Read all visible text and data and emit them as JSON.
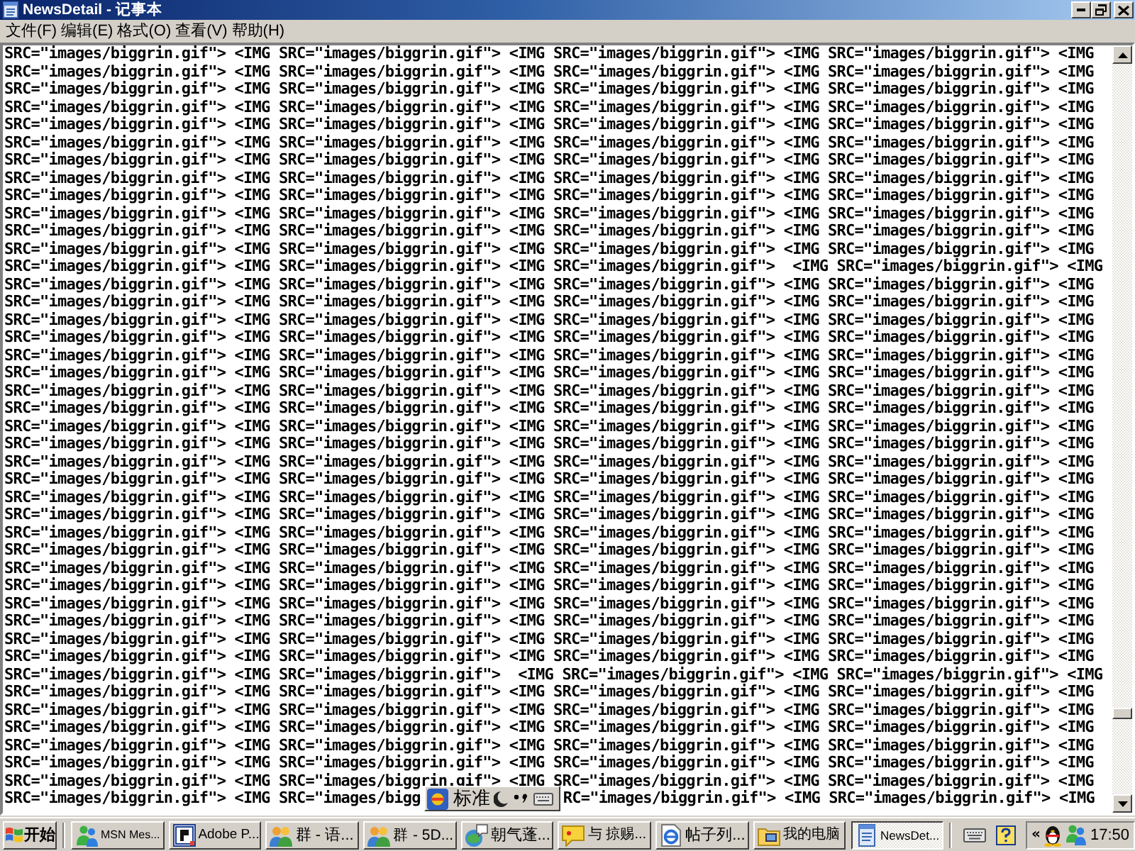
{
  "window": {
    "title": "NewsDetail - 记事本"
  },
  "menu": [
    "文件(F)",
    "编辑(E)",
    "格式(O)",
    "查看(V)",
    "帮助(H)"
  ],
  "editor": {
    "lines": [
      "SRC=\"images/biggrin.gif\"> <IMG SRC=\"images/biggrin.gif\"> <IMG SRC=\"images/biggrin.gif\"> <IMG SRC=\"images/biggrin.gif\"> <IMG",
      "SRC=\"images/biggrin.gif\"> <IMG SRC=\"images/biggrin.gif\"> <IMG SRC=\"images/biggrin.gif\"> <IMG SRC=\"images/biggrin.gif\"> <IMG",
      "SRC=\"images/biggrin.gif\"> <IMG SRC=\"images/biggrin.gif\"> <IMG SRC=\"images/biggrin.gif\"> <IMG SRC=\"images/biggrin.gif\"> <IMG",
      "SRC=\"images/biggrin.gif\"> <IMG SRC=\"images/biggrin.gif\"> <IMG SRC=\"images/biggrin.gif\"> <IMG SRC=\"images/biggrin.gif\"> <IMG",
      "SRC=\"images/biggrin.gif\"> <IMG SRC=\"images/biggrin.gif\"> <IMG SRC=\"images/biggrin.gif\"> <IMG SRC=\"images/biggrin.gif\"> <IMG",
      "SRC=\"images/biggrin.gif\"> <IMG SRC=\"images/biggrin.gif\"> <IMG SRC=\"images/biggrin.gif\"> <IMG SRC=\"images/biggrin.gif\"> <IMG",
      "SRC=\"images/biggrin.gif\"> <IMG SRC=\"images/biggrin.gif\"> <IMG SRC=\"images/biggrin.gif\"> <IMG SRC=\"images/biggrin.gif\"> <IMG",
      "SRC=\"images/biggrin.gif\"> <IMG SRC=\"images/biggrin.gif\"> <IMG SRC=\"images/biggrin.gif\"> <IMG SRC=\"images/biggrin.gif\"> <IMG",
      "SRC=\"images/biggrin.gif\"> <IMG SRC=\"images/biggrin.gif\"> <IMG SRC=\"images/biggrin.gif\"> <IMG SRC=\"images/biggrin.gif\"> <IMG",
      "SRC=\"images/biggrin.gif\"> <IMG SRC=\"images/biggrin.gif\"> <IMG SRC=\"images/biggrin.gif\"> <IMG SRC=\"images/biggrin.gif\"> <IMG",
      "SRC=\"images/biggrin.gif\"> <IMG SRC=\"images/biggrin.gif\"> <IMG SRC=\"images/biggrin.gif\"> <IMG SRC=\"images/biggrin.gif\"> <IMG",
      "SRC=\"images/biggrin.gif\"> <IMG SRC=\"images/biggrin.gif\"> <IMG SRC=\"images/biggrin.gif\"> <IMG SRC=\"images/biggrin.gif\"> <IMG",
      "SRC=\"images/biggrin.gif\"> <IMG SRC=\"images/biggrin.gif\"> <IMG SRC=\"images/biggrin.gif\">  <IMG SRC=\"images/biggrin.gif\"> <IMG",
      "SRC=\"images/biggrin.gif\"> <IMG SRC=\"images/biggrin.gif\"> <IMG SRC=\"images/biggrin.gif\"> <IMG SRC=\"images/biggrin.gif\"> <IMG",
      "SRC=\"images/biggrin.gif\"> <IMG SRC=\"images/biggrin.gif\"> <IMG SRC=\"images/biggrin.gif\"> <IMG SRC=\"images/biggrin.gif\"> <IMG",
      "SRC=\"images/biggrin.gif\"> <IMG SRC=\"images/biggrin.gif\"> <IMG SRC=\"images/biggrin.gif\"> <IMG SRC=\"images/biggrin.gif\"> <IMG",
      "SRC=\"images/biggrin.gif\"> <IMG SRC=\"images/biggrin.gif\"> <IMG SRC=\"images/biggrin.gif\"> <IMG SRC=\"images/biggrin.gif\"> <IMG",
      "SRC=\"images/biggrin.gif\"> <IMG SRC=\"images/biggrin.gif\"> <IMG SRC=\"images/biggrin.gif\"> <IMG SRC=\"images/biggrin.gif\"> <IMG",
      "SRC=\"images/biggrin.gif\"> <IMG SRC=\"images/biggrin.gif\"> <IMG SRC=\"images/biggrin.gif\"> <IMG SRC=\"images/biggrin.gif\"> <IMG",
      "SRC=\"images/biggrin.gif\"> <IMG SRC=\"images/biggrin.gif\"> <IMG SRC=\"images/biggrin.gif\"> <IMG SRC=\"images/biggrin.gif\"> <IMG",
      "SRC=\"images/biggrin.gif\"> <IMG SRC=\"images/biggrin.gif\"> <IMG SRC=\"images/biggrin.gif\"> <IMG SRC=\"images/biggrin.gif\"> <IMG",
      "SRC=\"images/biggrin.gif\"> <IMG SRC=\"images/biggrin.gif\"> <IMG SRC=\"images/biggrin.gif\"> <IMG SRC=\"images/biggrin.gif\"> <IMG",
      "SRC=\"images/biggrin.gif\"> <IMG SRC=\"images/biggrin.gif\"> <IMG SRC=\"images/biggrin.gif\"> <IMG SRC=\"images/biggrin.gif\"> <IMG",
      "SRC=\"images/biggrin.gif\"> <IMG SRC=\"images/biggrin.gif\"> <IMG SRC=\"images/biggrin.gif\"> <IMG SRC=\"images/biggrin.gif\"> <IMG",
      "SRC=\"images/biggrin.gif\"> <IMG SRC=\"images/biggrin.gif\"> <IMG SRC=\"images/biggrin.gif\"> <IMG SRC=\"images/biggrin.gif\"> <IMG",
      "SRC=\"images/biggrin.gif\"> <IMG SRC=\"images/biggrin.gif\"> <IMG SRC=\"images/biggrin.gif\"> <IMG SRC=\"images/biggrin.gif\"> <IMG",
      "SRC=\"images/biggrin.gif\"> <IMG SRC=\"images/biggrin.gif\"> <IMG SRC=\"images/biggrin.gif\"> <IMG SRC=\"images/biggrin.gif\"> <IMG",
      "SRC=\"images/biggrin.gif\"> <IMG SRC=\"images/biggrin.gif\"> <IMG SRC=\"images/biggrin.gif\"> <IMG SRC=\"images/biggrin.gif\"> <IMG",
      "SRC=\"images/biggrin.gif\"> <IMG SRC=\"images/biggrin.gif\"> <IMG SRC=\"images/biggrin.gif\"> <IMG SRC=\"images/biggrin.gif\"> <IMG",
      "SRC=\"images/biggrin.gif\"> <IMG SRC=\"images/biggrin.gif\"> <IMG SRC=\"images/biggrin.gif\"> <IMG SRC=\"images/biggrin.gif\"> <IMG",
      "SRC=\"images/biggrin.gif\"> <IMG SRC=\"images/biggrin.gif\"> <IMG SRC=\"images/biggrin.gif\"> <IMG SRC=\"images/biggrin.gif\"> <IMG",
      "SRC=\"images/biggrin.gif\"> <IMG SRC=\"images/biggrin.gif\"> <IMG SRC=\"images/biggrin.gif\"> <IMG SRC=\"images/biggrin.gif\"> <IMG",
      "SRC=\"images/biggrin.gif\"> <IMG SRC=\"images/biggrin.gif\"> <IMG SRC=\"images/biggrin.gif\"> <IMG SRC=\"images/biggrin.gif\"> <IMG",
      "SRC=\"images/biggrin.gif\"> <IMG SRC=\"images/biggrin.gif\"> <IMG SRC=\"images/biggrin.gif\"> <IMG SRC=\"images/biggrin.gif\"> <IMG",
      "SRC=\"images/biggrin.gif\"> <IMG SRC=\"images/biggrin.gif\"> <IMG SRC=\"images/biggrin.gif\"> <IMG SRC=\"images/biggrin.gif\"> <IMG",
      "SRC=\"images/biggrin.gif\"> <IMG SRC=\"images/biggrin.gif\">  <IMG SRC=\"images/biggrin.gif\"> <IMG SRC=\"images/biggrin.gif\"> <IMG",
      "SRC=\"images/biggrin.gif\"> <IMG SRC=\"images/biggrin.gif\"> <IMG SRC=\"images/biggrin.gif\"> <IMG SRC=\"images/biggrin.gif\"> <IMG",
      "SRC=\"images/biggrin.gif\"> <IMG SRC=\"images/biggrin.gif\"> <IMG SRC=\"images/biggrin.gif\"> <IMG SRC=\"images/biggrin.gif\"> <IMG",
      "SRC=\"images/biggrin.gif\"> <IMG SRC=\"images/biggrin.gif\"> <IMG SRC=\"images/biggrin.gif\"> <IMG SRC=\"images/biggrin.gif\"> <IMG",
      "SRC=\"images/biggrin.gif\"> <IMG SRC=\"images/biggrin.gif\"> <IMG SRC=\"images/biggrin.gif\"> <IMG SRC=\"images/biggrin.gif\"> <IMG",
      "SRC=\"images/biggrin.gif\"> <IMG SRC=\"images/biggrin.gif\"> <IMG SRC=\"images/biggrin.gif\"> <IMG SRC=\"images/biggrin.gif\"> <IMG",
      "SRC=\"images/biggrin.gif\"> <IMG SRC=\"images/biggrin.gif\"> <IMG SRC=\"images/biggrin.gif\"> <IMG SRC=\"images/biggrin.gif\"> <IMG"
    ],
    "covered_line": {
      "left": "SRC=\"images/biggrin.gif\"> <IMG SRC=\"images/bigg",
      "right": "RC=\"images/biggrin.gif\"> <IMG SRC=\"images/biggrin.gif\"> <IMG"
    }
  },
  "language_bar": {
    "mode": "标准"
  },
  "taskbar": {
    "start": "开始",
    "tasks": [
      {
        "label": "MSN Mes...",
        "selected": false
      },
      {
        "label": "Adobe P...",
        "selected": false
      },
      {
        "label": "群 - 语...",
        "selected": false
      },
      {
        "label": "群 - 5D...",
        "selected": false
      },
      {
        "label": "朝气蓬...",
        "selected": false
      },
      {
        "label": "与 掠赐...",
        "selected": false
      },
      {
        "label": "帖子列...",
        "selected": false
      },
      {
        "label": "我的电脑",
        "selected": false
      },
      {
        "label": "NewsDet...",
        "selected": true
      }
    ],
    "tray_toggle": "«",
    "clock": "17:50"
  }
}
